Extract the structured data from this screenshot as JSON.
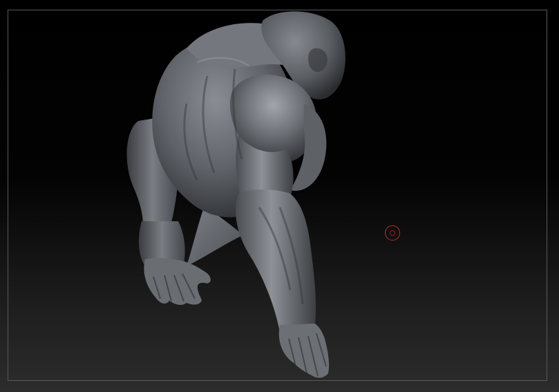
{
  "viewport": {
    "background_top": "#000000",
    "background_bottom": "#2c2c2c",
    "frame_color": "#5a5a5a"
  },
  "model": {
    "material_color": "#6f7278",
    "shadow_color": "#2a2c30",
    "highlight_color": "#9a9ea4"
  },
  "cursor": {
    "icon": "brush-cursor-icon",
    "color": "#c0262a"
  }
}
